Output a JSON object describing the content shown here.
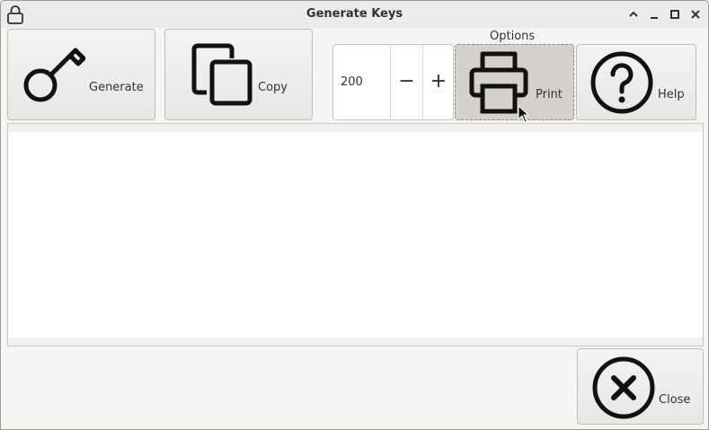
{
  "window": {
    "title": "Generate Keys"
  },
  "titlebar_icons": [
    "lock-icon",
    "chevron-up-icon",
    "minimize-icon",
    "maximize-icon",
    "close-icon"
  ],
  "toolbar": {
    "generate_label": "Generate",
    "copy_label": "Copy",
    "options_label": "Options",
    "count_value": "200",
    "decrement_symbol": "−",
    "increment_symbol": "+",
    "print_label": "Print",
    "help_label": "Help"
  },
  "output": {
    "text": ""
  },
  "footer": {
    "close_label": "Close"
  },
  "colors": {
    "window_bg": "#f6f5f4",
    "button_bg": "#ebeae8",
    "pressed_bg": "#d4d0cc",
    "text": "#2e3436"
  }
}
